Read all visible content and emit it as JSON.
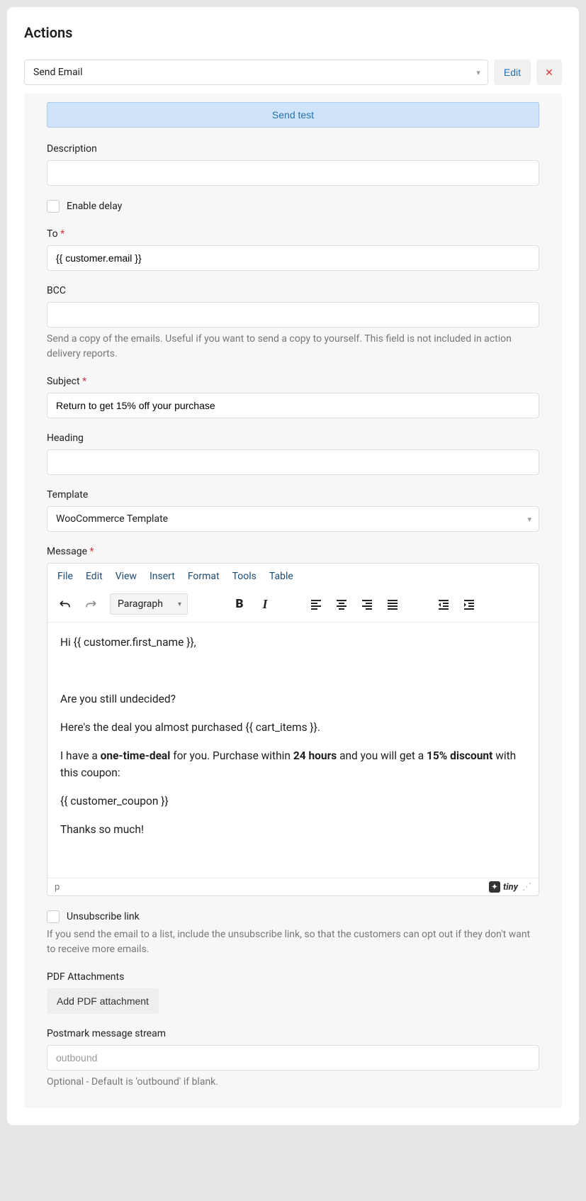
{
  "title": "Actions",
  "actionSelect": "Send Email",
  "editBtn": "Edit",
  "sendTest": "Send test",
  "labels": {
    "description": "Description",
    "enableDelay": "Enable delay",
    "to": "To",
    "bcc": "BCC",
    "subject": "Subject",
    "heading": "Heading",
    "template": "Template",
    "message": "Message",
    "unsubscribe": "Unsubscribe link",
    "pdf": "PDF Attachments",
    "postmark": "Postmark message stream"
  },
  "values": {
    "to": "{{ customer.email }}",
    "subject": "Return to get 15% off your purchase",
    "template": "WooCommerce Template",
    "postmarkPlaceholder": "outbound"
  },
  "help": {
    "bcc": "Send a copy of the emails. Useful if you want to send a copy to yourself. This field is not included in action delivery reports.",
    "unsubscribe": "If you send the email to a list, include the unsubscribe link, so that the customers can opt out if they don't want to receive more emails.",
    "postmark": "Optional - Default is 'outbound' if blank."
  },
  "editor": {
    "menus": [
      "File",
      "Edit",
      "View",
      "Insert",
      "Format",
      "Tools",
      "Table"
    ],
    "blockFormat": "Paragraph",
    "statusPath": "p",
    "brand": "tiny",
    "content": {
      "p1": "Hi {{ customer.first_name }},",
      "p2": "Are you still undecided?",
      "p3": "Here's the deal you almost purchased {{ cart_items }}.",
      "p4_a": "I have a ",
      "p4_b": "one-time-deal",
      "p4_c": " for you. Purchase within ",
      "p4_d": "24 hours",
      "p4_e": " and you will get a ",
      "p4_f": "15% discount",
      "p4_g": " with this coupon:",
      "p5": "{{ customer_coupon }}",
      "p6": "Thanks so much!"
    }
  },
  "addPdf": "Add PDF attachment"
}
